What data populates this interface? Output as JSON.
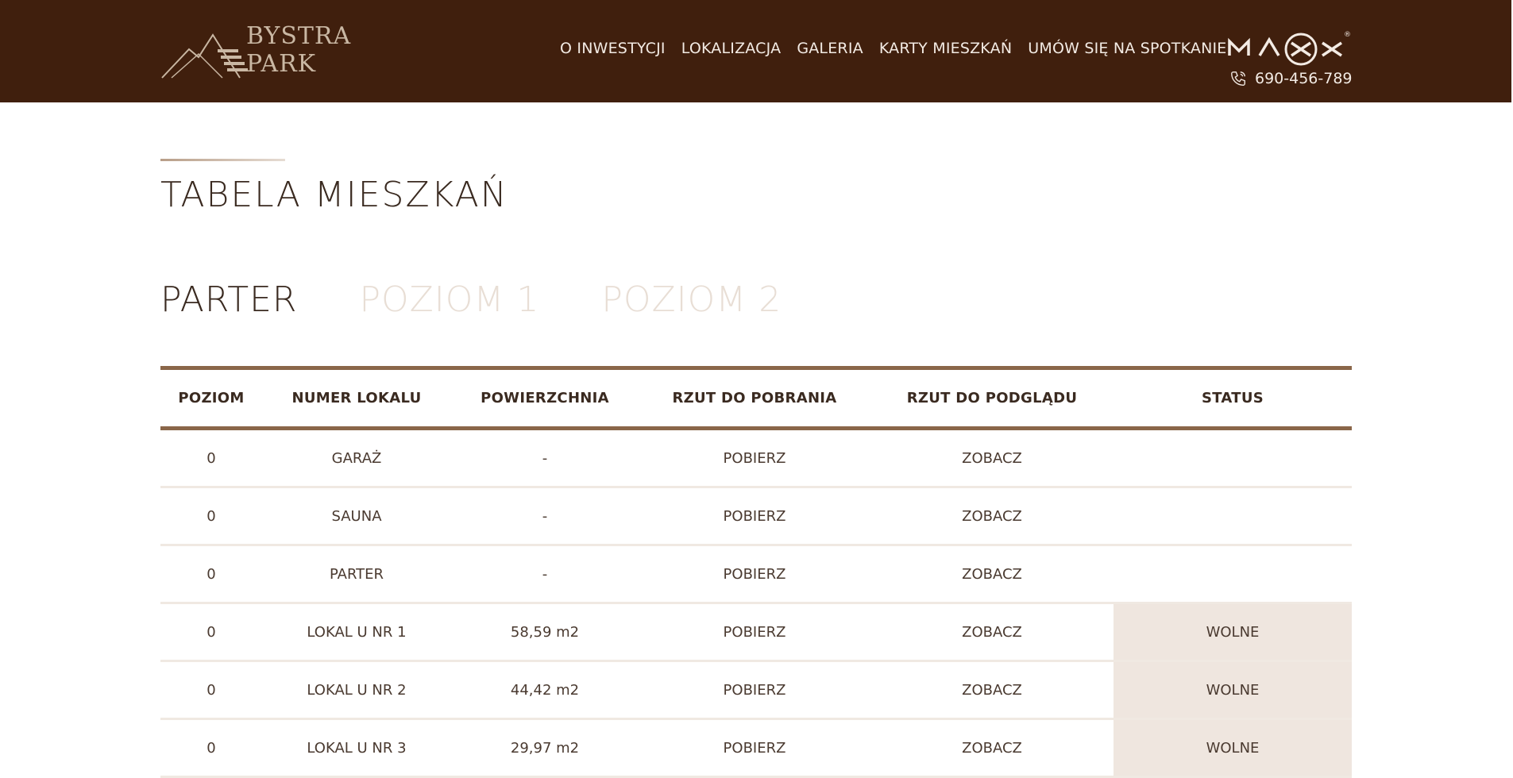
{
  "logo": {
    "line1": "BYSTRA",
    "line2": "PARK"
  },
  "nav": [
    "O INWESTYCJI",
    "LOKALIZACJA",
    "GALERIA",
    "KARTY MIESZKAŃ",
    "UMÓW SIĘ NA SPOTKANIE"
  ],
  "brand": {
    "mark": "MAXX",
    "registered": "®"
  },
  "phone": "690-456-789",
  "page_title": "TABELA MIESZKAŃ",
  "tabs": [
    "PARTER",
    "POZIOM 1",
    "POZIOM 2"
  ],
  "active_tab": "PARTER",
  "table": {
    "headers": [
      "POZIOM",
      "NUMER LOKALU",
      "POWIERZCHNIA",
      "RZUT DO POBRANIA",
      "RZUT DO PODGLĄDU",
      "STATUS"
    ],
    "rows": [
      [
        "0",
        "GARAŻ",
        "-",
        "POBIERZ",
        "ZOBACZ",
        ""
      ],
      [
        "0",
        "SAUNA",
        "-",
        "POBIERZ",
        "ZOBACZ",
        ""
      ],
      [
        "0",
        "PARTER",
        "-",
        "POBIERZ",
        "ZOBACZ",
        ""
      ],
      [
        "0",
        "LOKAL U NR 1",
        "58,59 m2",
        "POBIERZ",
        "ZOBACZ",
        "WOLNE"
      ],
      [
        "0",
        "LOKAL U NR 2",
        "44,42 m2",
        "POBIERZ",
        "ZOBACZ",
        "WOLNE"
      ],
      [
        "0",
        "LOKAL U NR 3",
        "29,97 m2",
        "POBIERZ",
        "ZOBACZ",
        "WOLNE"
      ]
    ]
  },
  "colors": {
    "header_bg": "#401f0d",
    "accent": "#8a6649",
    "status_free_bg": "#efe6df"
  }
}
